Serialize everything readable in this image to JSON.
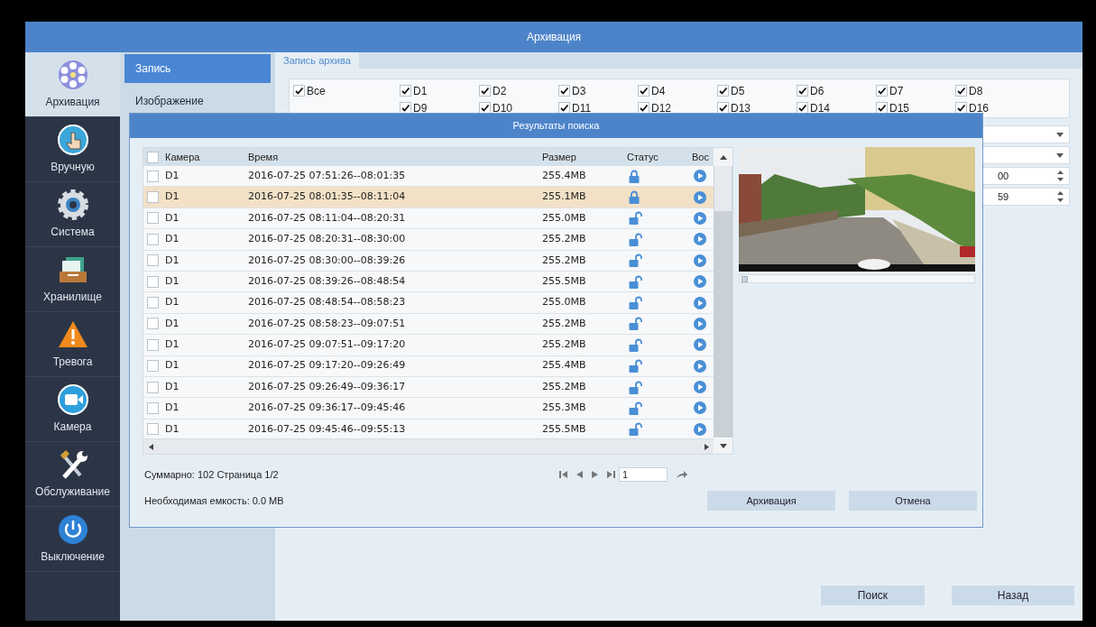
{
  "window": {
    "title": "Архивация"
  },
  "nav": [
    {
      "label": "Архивация",
      "selected": true
    },
    {
      "label": "Вручную",
      "selected": false
    },
    {
      "label": "Система",
      "selected": false
    },
    {
      "label": "Хранилище",
      "selected": false
    },
    {
      "label": "Тревога",
      "selected": false
    },
    {
      "label": "Камера",
      "selected": false
    },
    {
      "label": "Обслуживание",
      "selected": false
    },
    {
      "label": "Выключение",
      "selected": false
    }
  ],
  "submenu": [
    {
      "label": "Запись",
      "selected": true
    },
    {
      "label": "Изображение",
      "selected": false
    }
  ],
  "tab": {
    "label": "Запись архива",
    "selected": true
  },
  "channels": {
    "all": {
      "label": "Все",
      "checked": true
    },
    "list": [
      {
        "label": "D1",
        "checked": true
      },
      {
        "label": "D2",
        "checked": true
      },
      {
        "label": "D3",
        "checked": true
      },
      {
        "label": "D4",
        "checked": true
      },
      {
        "label": "D5",
        "checked": true
      },
      {
        "label": "D6",
        "checked": true
      },
      {
        "label": "D7",
        "checked": true
      },
      {
        "label": "D8",
        "checked": true
      },
      {
        "label": "D9",
        "checked": true
      },
      {
        "label": "D10",
        "checked": true
      },
      {
        "label": "D11",
        "checked": true
      },
      {
        "label": "D12",
        "checked": true
      },
      {
        "label": "D13",
        "checked": true
      },
      {
        "label": "D14",
        "checked": true
      },
      {
        "label": "D15",
        "checked": true
      },
      {
        "label": "D16",
        "checked": true
      }
    ]
  },
  "fields": [
    {
      "kind": "dropdown"
    },
    {
      "kind": "dropdown"
    },
    {
      "kind": "spinner",
      "value": "00"
    },
    {
      "kind": "spinner",
      "value": "59"
    }
  ],
  "buttons": [
    "Поиск",
    "Назад"
  ],
  "dialog": {
    "title": "Результаты поиска",
    "columns": [
      "Камера",
      "Время",
      "Размер",
      "Статус",
      "Вос"
    ],
    "rows": [
      {
        "camera": "D1",
        "time": "2016-07-25 07:51:26--08:01:35",
        "size": "255.4MB",
        "locked": true,
        "selected": false,
        "checked": false
      },
      {
        "camera": "D1",
        "time": "2016-07-25 08:01:35--08:11:04",
        "size": "255.1MB",
        "locked": true,
        "selected": true,
        "checked": false
      },
      {
        "camera": "D1",
        "time": "2016-07-25 08:11:04--08:20:31",
        "size": "255.0MB",
        "locked": false,
        "selected": false,
        "checked": false
      },
      {
        "camera": "D1",
        "time": "2016-07-25 08:20:31--08:30:00",
        "size": "255.2MB",
        "locked": false,
        "selected": false,
        "checked": false
      },
      {
        "camera": "D1",
        "time": "2016-07-25 08:30:00--08:39:26",
        "size": "255.2MB",
        "locked": false,
        "selected": false,
        "checked": false
      },
      {
        "camera": "D1",
        "time": "2016-07-25 08:39:26--08:48:54",
        "size": "255.5MB",
        "locked": false,
        "selected": false,
        "checked": false
      },
      {
        "camera": "D1",
        "time": "2016-07-25 08:48:54--08:58:23",
        "size": "255.0MB",
        "locked": false,
        "selected": false,
        "checked": false
      },
      {
        "camera": "D1",
        "time": "2016-07-25 08:58:23--09:07:51",
        "size": "255.2MB",
        "locked": false,
        "selected": false,
        "checked": false
      },
      {
        "camera": "D1",
        "time": "2016-07-25 09:07:51--09:17:20",
        "size": "255.2MB",
        "locked": false,
        "selected": false,
        "checked": false
      },
      {
        "camera": "D1",
        "time": "2016-07-25 09:17:20--09:26:49",
        "size": "255.4MB",
        "locked": false,
        "selected": false,
        "checked": false
      },
      {
        "camera": "D1",
        "time": "2016-07-25 09:26:49--09:36:17",
        "size": "255.2MB",
        "locked": false,
        "selected": false,
        "checked": false
      },
      {
        "camera": "D1",
        "time": "2016-07-25 09:36:17--09:45:46",
        "size": "255.3MB",
        "locked": false,
        "selected": false,
        "checked": false
      },
      {
        "camera": "D1",
        "time": "2016-07-25 09:45:46--09:55:13",
        "size": "255.5MB",
        "locked": false,
        "selected": false,
        "checked": false
      }
    ],
    "header_checked": false,
    "playback": {
      "level": 0
    },
    "summary": "Суммарно: 102 Страница 1/2",
    "page": "1",
    "capacity": "Необходимая емкость: 0.0 MB",
    "buttons": [
      "Архивация",
      "Отмена"
    ]
  }
}
